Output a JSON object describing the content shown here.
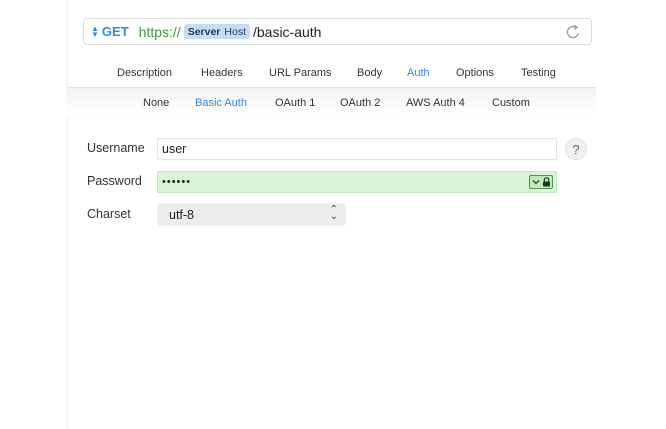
{
  "request": {
    "method": "GET",
    "url_scheme": "https://",
    "url_token": {
      "bold": "Server",
      "rest": "Host"
    },
    "url_path": "/basic-auth"
  },
  "tabs": [
    {
      "label": "Description",
      "active": false
    },
    {
      "label": "Headers",
      "active": false
    },
    {
      "label": "URL Params",
      "active": false
    },
    {
      "label": "Body",
      "active": false
    },
    {
      "label": "Auth",
      "active": true
    },
    {
      "label": "Options",
      "active": false
    },
    {
      "label": "Testing",
      "active": false
    }
  ],
  "auth_tabs": [
    {
      "label": "None",
      "active": false
    },
    {
      "label": "Basic Auth",
      "active": true
    },
    {
      "label": "OAuth 1",
      "active": false
    },
    {
      "label": "OAuth 2",
      "active": false
    },
    {
      "label": "AWS Auth 4",
      "active": false
    },
    {
      "label": "Custom",
      "active": false
    }
  ],
  "form": {
    "username_label": "Username",
    "username_value": "user",
    "password_label": "Password",
    "password_value": "••••••",
    "charset_label": "Charset",
    "charset_value": "utf-8",
    "help_label": "?"
  },
  "colors": {
    "accent": "#2e8ae6",
    "scheme_green": "#3a9a3a",
    "password_bg": "#d8f5d8"
  },
  "icons": {
    "refresh": "refresh-icon",
    "keychain": "keychain-lock-icon",
    "method_chevron": "up-down-chevron-icon"
  }
}
